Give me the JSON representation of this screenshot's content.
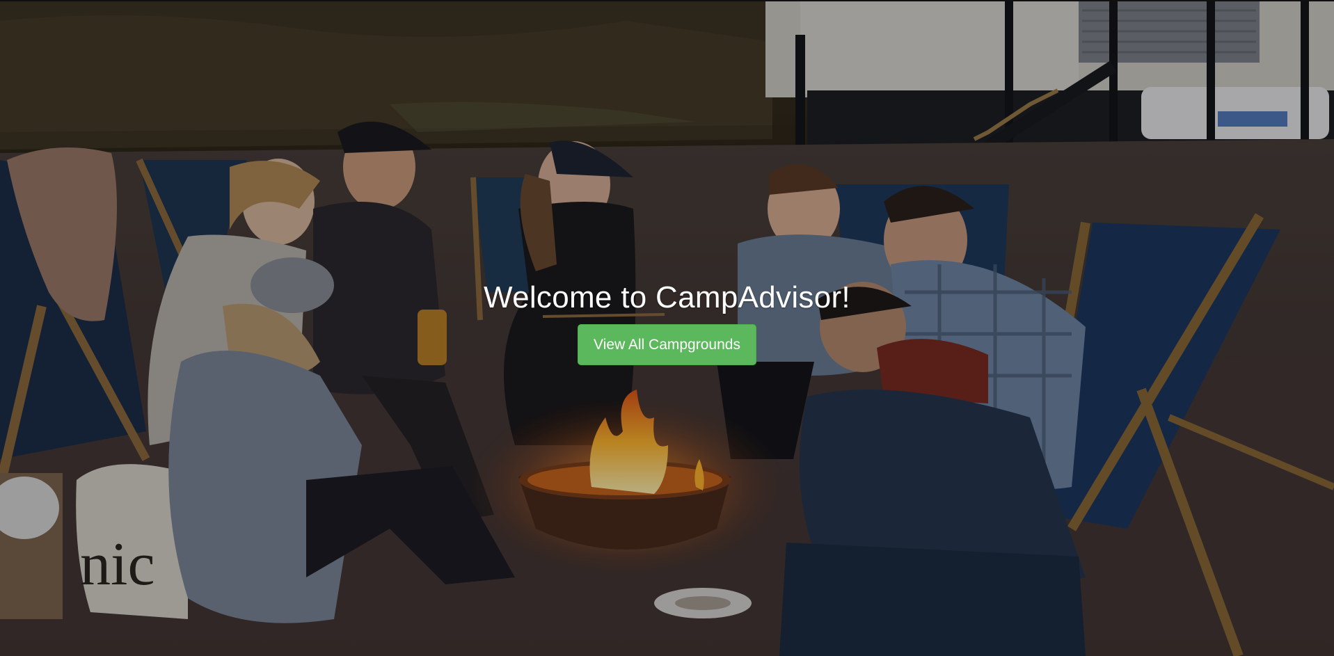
{
  "hero": {
    "title": "Welcome to CampAdvisor!",
    "button_label": "View All Campgrounds",
    "background": "campfire-gathering-photo",
    "bag_text": "nic"
  },
  "colors": {
    "button_bg": "#5cb85c",
    "button_border": "#4cae4c",
    "title_text": "#ffffff"
  }
}
